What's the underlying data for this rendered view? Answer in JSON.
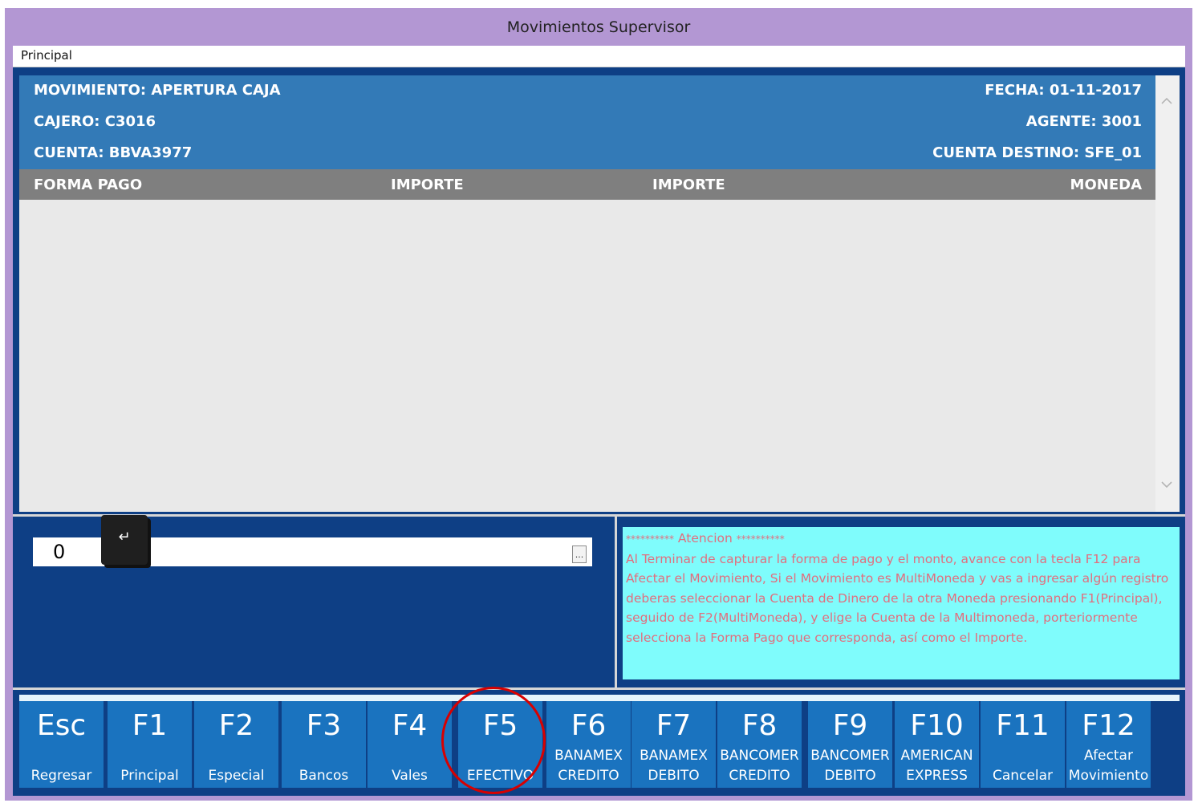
{
  "window": {
    "title": "Movimientos Supervisor",
    "menu": [
      "Principal"
    ]
  },
  "info": {
    "movimiento": "MOVIMIENTO: APERTURA CAJA",
    "fecha": "FECHA: 01-11-2017",
    "cajero": "CAJERO: C3016",
    "agente": "AGENTE: 3001",
    "cuenta": "CUENTA: BBVA3977",
    "cuenta_destino": "CUENTA DESTINO: SFE_01"
  },
  "columns": [
    "FORMA PAGO",
    "IMPORTE",
    "IMPORTE",
    "MONEDA"
  ],
  "rows": [],
  "input": {
    "value": "0",
    "ellipsis": "...",
    "enter_key": "↵"
  },
  "notice": {
    "heading_prefix": "**********",
    "heading": " Atencion ",
    "heading_suffix": "**********",
    "body": "Al Terminar de capturar la forma de pago y el monto, avance con la tecla F12 para Afectar el Movimiento, Si el Movimiento es MultiMoneda y vas a ingresar algún registro deberas seleccionar la Cuenta de Dinero de la otra Moneda presionando F1(Principal), seguido de F2(MultiMoneda), y elige la Cuenta de la Multimoneda, porteriormente selecciona la Forma Pago que corresponda, así como el Importe."
  },
  "function_keys": [
    {
      "key": "Esc",
      "line1": "",
      "line2": "Regresar"
    },
    {
      "key": "F1",
      "line1": "",
      "line2": "Principal"
    },
    {
      "key": "F2",
      "line1": "",
      "line2": "Especial"
    },
    {
      "key": "F3",
      "line1": "",
      "line2": "Bancos"
    },
    {
      "key": "F4",
      "line1": "",
      "line2": "Vales"
    },
    {
      "key": "F5",
      "line1": "",
      "line2": "EFECTIVO"
    },
    {
      "key": "F6",
      "line1": "BANAMEX",
      "line2": "CREDITO"
    },
    {
      "key": "F7",
      "line1": "BANAMEX",
      "line2": "DEBITO"
    },
    {
      "key": "F8",
      "line1": "BANCOMER",
      "line2": "CREDITO"
    },
    {
      "key": "F9",
      "line1": "BANCOMER",
      "line2": "DEBITO"
    },
    {
      "key": "F10",
      "line1": "AMERICAN",
      "line2": "EXPRESS"
    },
    {
      "key": "F11",
      "line1": "",
      "line2": "Cancelar"
    },
    {
      "key": "F12",
      "line1": "Afectar",
      "line2": "Movimiento"
    }
  ],
  "colors": {
    "title_bar": "#b397d3",
    "panel_bg": "#0e3f85",
    "header_blue": "#337ab7",
    "column_gray": "#7f7f7f",
    "fkey_blue": "#1a73bf",
    "notice_bg": "#7ffcfc",
    "notice_text": "#e26e7e",
    "annotation_circle": "#d80000"
  },
  "annotation": {
    "highlighted_key": "F5"
  }
}
